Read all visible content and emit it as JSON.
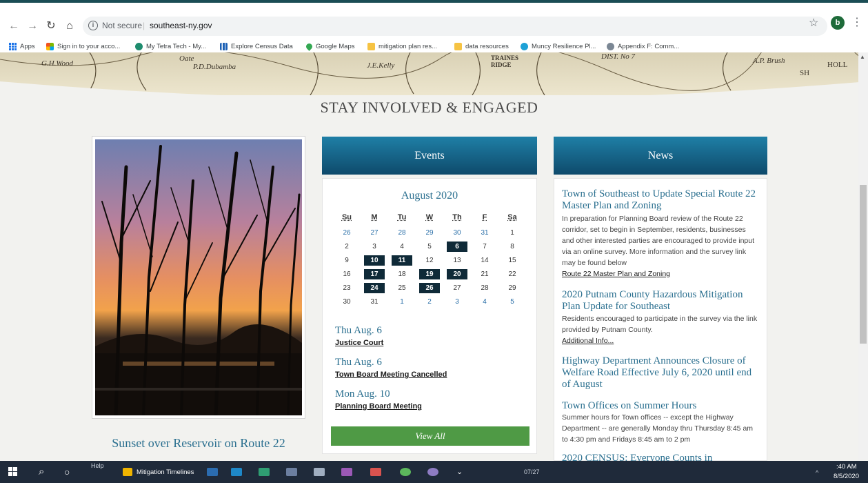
{
  "browser": {
    "security_label": "Not secure",
    "separator": "|",
    "url": "southeast-ny.gov",
    "profile_initial": "b",
    "bookmarks": [
      {
        "label": "Apps",
        "icon": "apps-grid-icon",
        "color": "#1a73e8"
      },
      {
        "label": "Sign in to your acco...",
        "icon": "microsoft-icon",
        "color": "#f25022"
      },
      {
        "label": "My Tetra Tech - My...",
        "icon": "tetra-tech-icon",
        "color": "#1e8c6e"
      },
      {
        "label": "Explore Census Data",
        "icon": "census-bars-icon",
        "color": "#1a5fb4"
      },
      {
        "label": "Google Maps",
        "icon": "map-pin-icon",
        "color": "#34a853"
      },
      {
        "label": "mitigation plan res...",
        "icon": "folder-icon",
        "color": "#f6c343"
      },
      {
        "label": "data resources",
        "icon": "folder-icon",
        "color": "#f6c343"
      },
      {
        "label": "Muncy Resilience Pl...",
        "icon": "muncy-icon",
        "color": "#1da1d6"
      },
      {
        "label": "Appendix F: Comm...",
        "icon": "appendix-icon",
        "color": "#7b8794"
      }
    ]
  },
  "banner": {
    "map_labels": [
      "G.H.Wood",
      "Oate",
      "P.D.Dubamba",
      "J.E.Kelly",
      "TRAINES RIDGE",
      "DIST. No 7",
      "A.P. Brush",
      "HOLL",
      "SH"
    ]
  },
  "page": {
    "section_title": "STAY INVOLVED & ENGAGED",
    "photo_caption": "Sunset over Reservoir on Route 22"
  },
  "events": {
    "header": "Events",
    "month": "August 2020",
    "weekdays": [
      "Su",
      "M",
      "Tu",
      "W",
      "Th",
      "F",
      "Sa"
    ],
    "weeks": [
      [
        "26",
        "27",
        "28",
        "29",
        "30",
        "31",
        "1"
      ],
      [
        "2",
        "3",
        "4",
        "5",
        "6",
        "7",
        "8"
      ],
      [
        "9",
        "10",
        "11",
        "12",
        "13",
        "14",
        "15"
      ],
      [
        "16",
        "17",
        "18",
        "19",
        "20",
        "21",
        "22"
      ],
      [
        "23",
        "24",
        "25",
        "26",
        "27",
        "28",
        "29"
      ],
      [
        "30",
        "31",
        "1",
        "2",
        "3",
        "4",
        "5"
      ]
    ],
    "event_days": [
      "6",
      "10",
      "11",
      "17",
      "19",
      "20",
      "24",
      "26"
    ],
    "items": [
      {
        "date": "Thu Aug. 6",
        "title": "Justice Court"
      },
      {
        "date": "Thu Aug. 6",
        "title": "Town Board Meeting Cancelled"
      },
      {
        "date": "Mon Aug. 10",
        "title": "Planning Board Meeting"
      }
    ],
    "view_all": "View All"
  },
  "news": {
    "header": "News",
    "items": [
      {
        "title": "Town of Southeast to Update Special Route 22 Master Plan and Zoning",
        "text": "In preparation for Planning Board review of the Route 22 corridor, set to begin in September, residents, businesses and other interested parties are encouraged to provide input via an online survey. More information and the survey link may be found below",
        "link": "Route 22 Master Plan and Zoning"
      },
      {
        "title": "2020 Putnam County Hazardous Mitigation Plan Update for Southeast",
        "text": "Residents encouraged to participate in the survey via the link provided by Putnam County.",
        "link": "Additional Info..."
      },
      {
        "title": "Highway Department Announces Closure of Welfare Road Effective July 6, 2020 until end of August",
        "text": "",
        "link": ""
      },
      {
        "title": "Town Offices on Summer Hours",
        "text": "Summer hours for Town offices -- except the Highway Department -- are generally Monday thru Thursday 8:45 am to 4:30 pm and Fridays 8:45 am to 2 pm",
        "link": ""
      },
      {
        "title": "2020 CENSUS: Everyone Counts in",
        "text": "",
        "link": ""
      }
    ]
  },
  "taskbar": {
    "help_tooltip": "Help",
    "active_window": "Mitigation Timelines",
    "counter": "07/27",
    "time": ":40 AM",
    "date": "8/5/2020"
  }
}
